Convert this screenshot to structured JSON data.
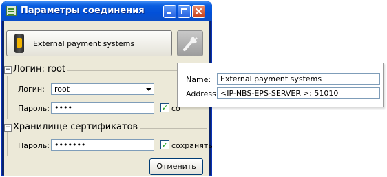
{
  "window": {
    "title": "Параметры соединения"
  },
  "connection": {
    "name": "External payment systems"
  },
  "login_group": {
    "header": "Логин: root",
    "collapse_glyph": "−",
    "login_label": "Логин:",
    "login_value": "root",
    "password_label": "Пароль:",
    "password_value": "••••",
    "save_checked": true,
    "save_label": "со"
  },
  "cert_group": {
    "header": "Хранилище сертификатов",
    "collapse_glyph": "−",
    "password_label": "Пароль:",
    "password_value": "•••••••",
    "save_checked": true,
    "save_label": "сохранять"
  },
  "buttons": {
    "cancel": "Отменить"
  },
  "popup": {
    "name_label": "Name:",
    "name_value": "External payment systems",
    "address_label": "Address:",
    "address_value_before_caret": "<IP-NBS-EPS-SERVER",
    "address_value_after_caret": ">: 51010"
  },
  "icons": {
    "title_icon": "settings-list-icon",
    "connection_icon": "terminal-icon",
    "wrench_icon": "wrench-icon",
    "minimize": "minimize-icon",
    "maximize": "maximize-icon",
    "close": "close-icon"
  },
  "colors": {
    "titlebar": "#0250d8",
    "client_bg": "#ece9d8",
    "input_border": "#7f9db9",
    "check_mark": "#21a121"
  }
}
